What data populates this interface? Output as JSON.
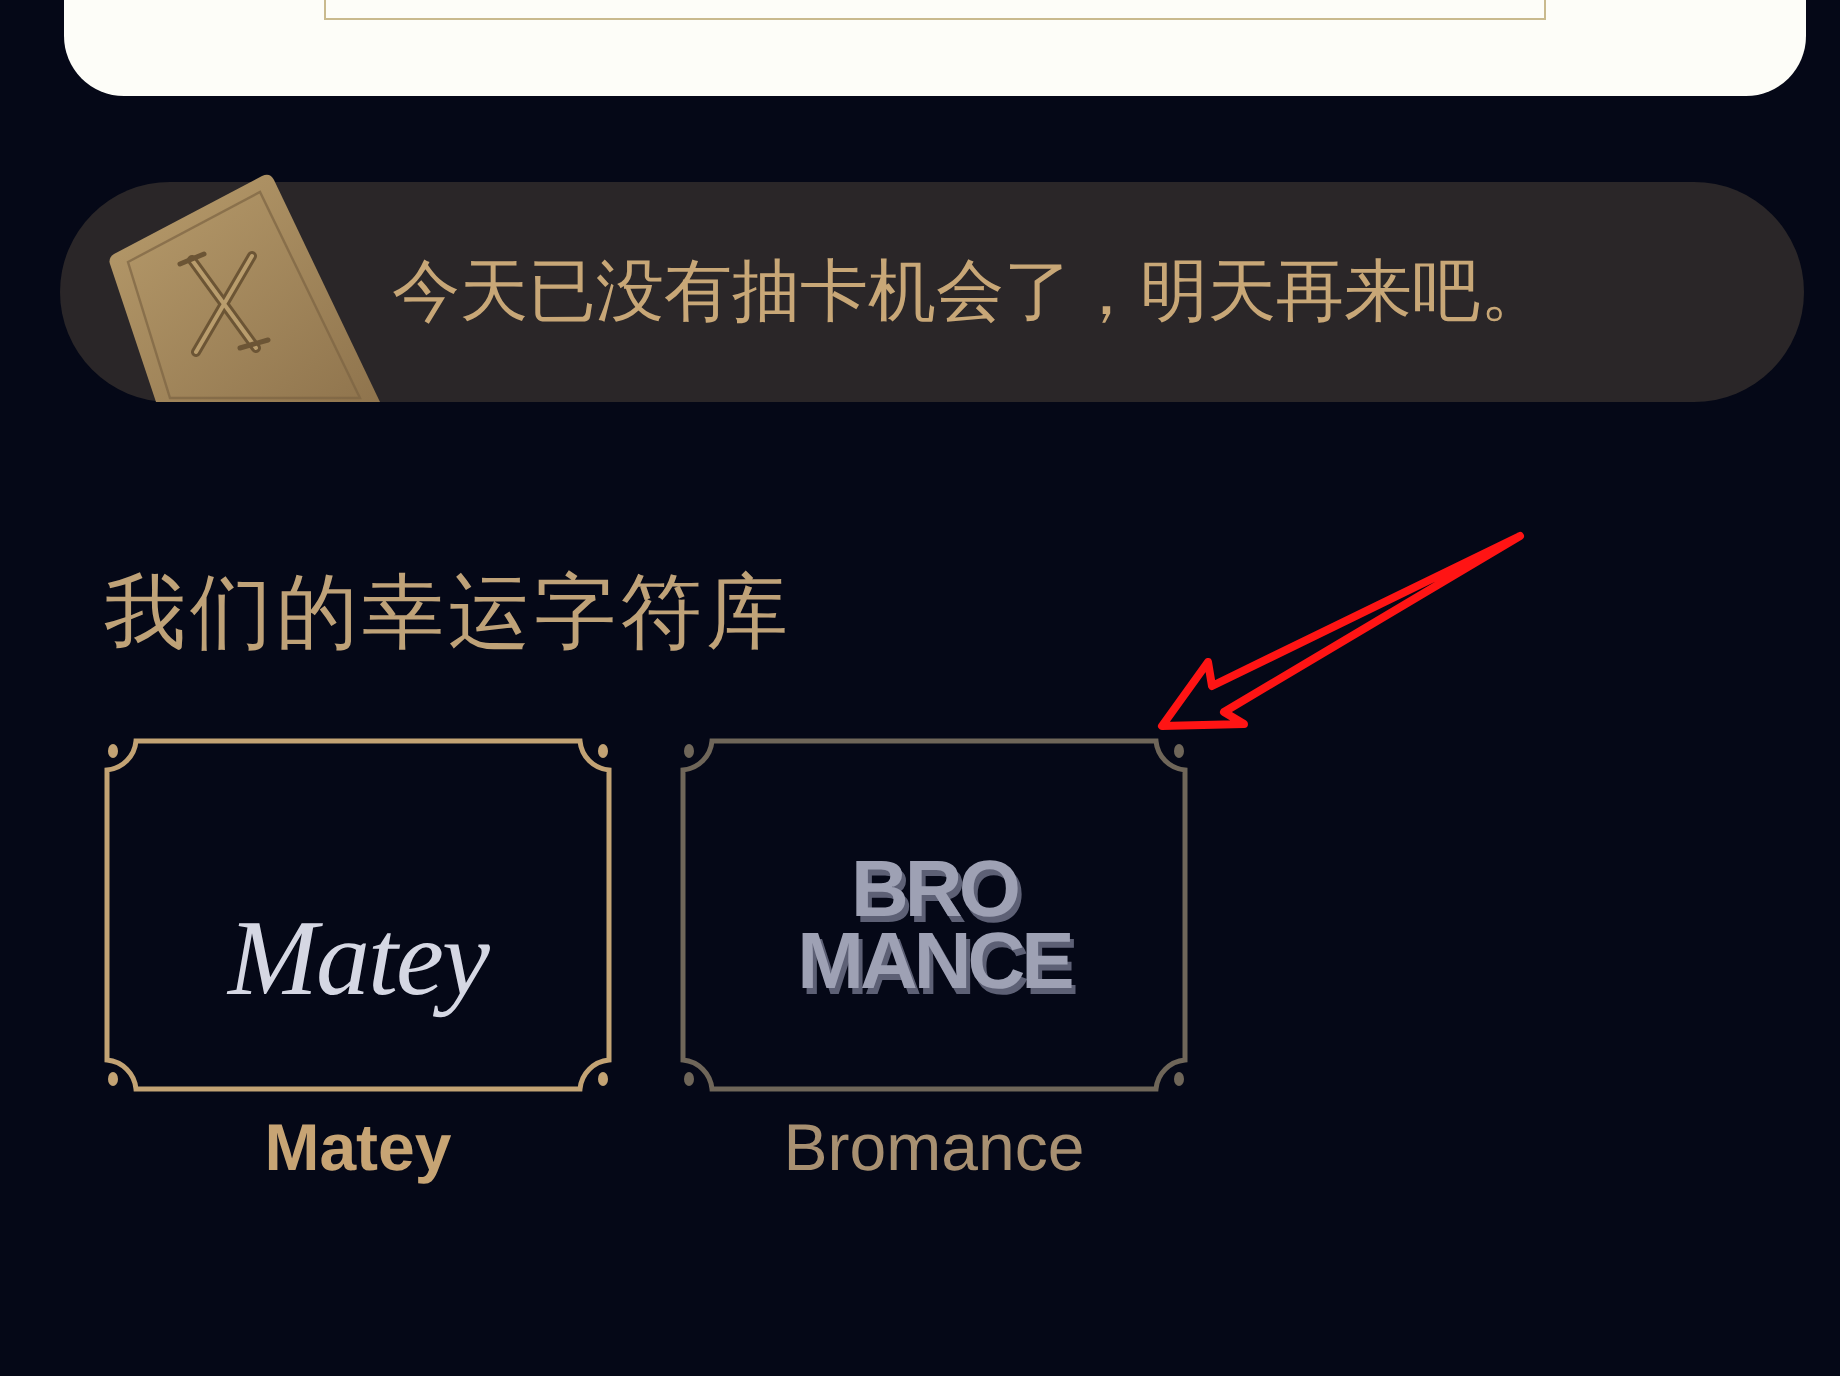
{
  "notice": {
    "text": "今天已没有抽卡机会了，明天再来吧。"
  },
  "section_title": "我们的幸运字符库",
  "libraries": [
    {
      "name": "Matey",
      "kind": "script",
      "logo_lines": [
        "Matey"
      ],
      "selected": true
    },
    {
      "name": "Bromance",
      "kind": "block",
      "logo_lines": [
        "BRO",
        "MANCE"
      ],
      "selected": false
    }
  ]
}
